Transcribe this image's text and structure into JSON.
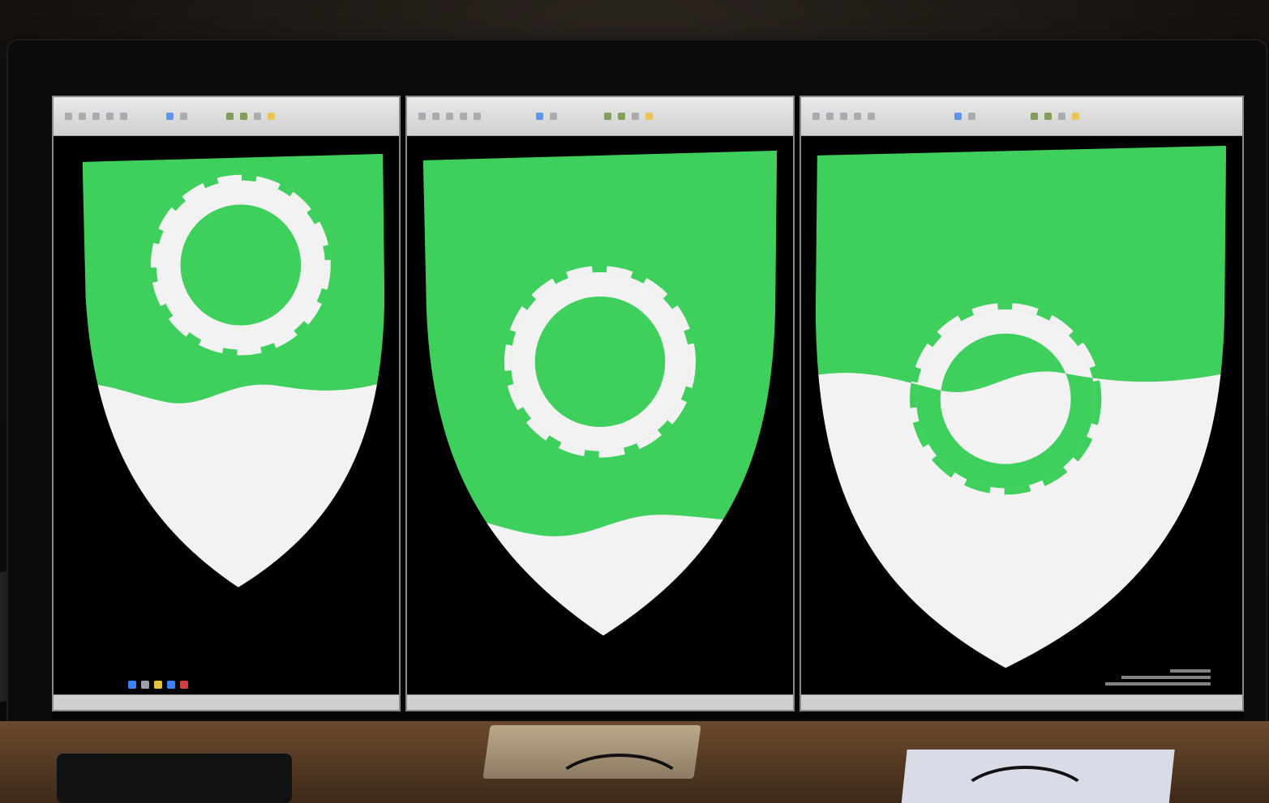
{
  "scene": {
    "description_type": "photo-of-monitor",
    "windows": [
      {
        "id": "left-window",
        "variant": "ring-above-wave",
        "green": "#3fcf5c",
        "white": "#f2f2f2"
      },
      {
        "id": "middle-window",
        "variant": "ring-green-field-wave-low",
        "green": "#3fcf5c",
        "white": "#f2f2f2"
      },
      {
        "id": "right-window",
        "variant": "ring-counterchanged-wave",
        "green": "#3fcf5c",
        "white": "#f2f2f2"
      }
    ],
    "colors": {
      "green": "#3fcf5c",
      "white": "#f2f2f2",
      "background": "#000000",
      "bezel": "#0b0b0c"
    },
    "icons": [
      "gear-ring-charge",
      "wave-division",
      "heater-shield"
    ]
  }
}
